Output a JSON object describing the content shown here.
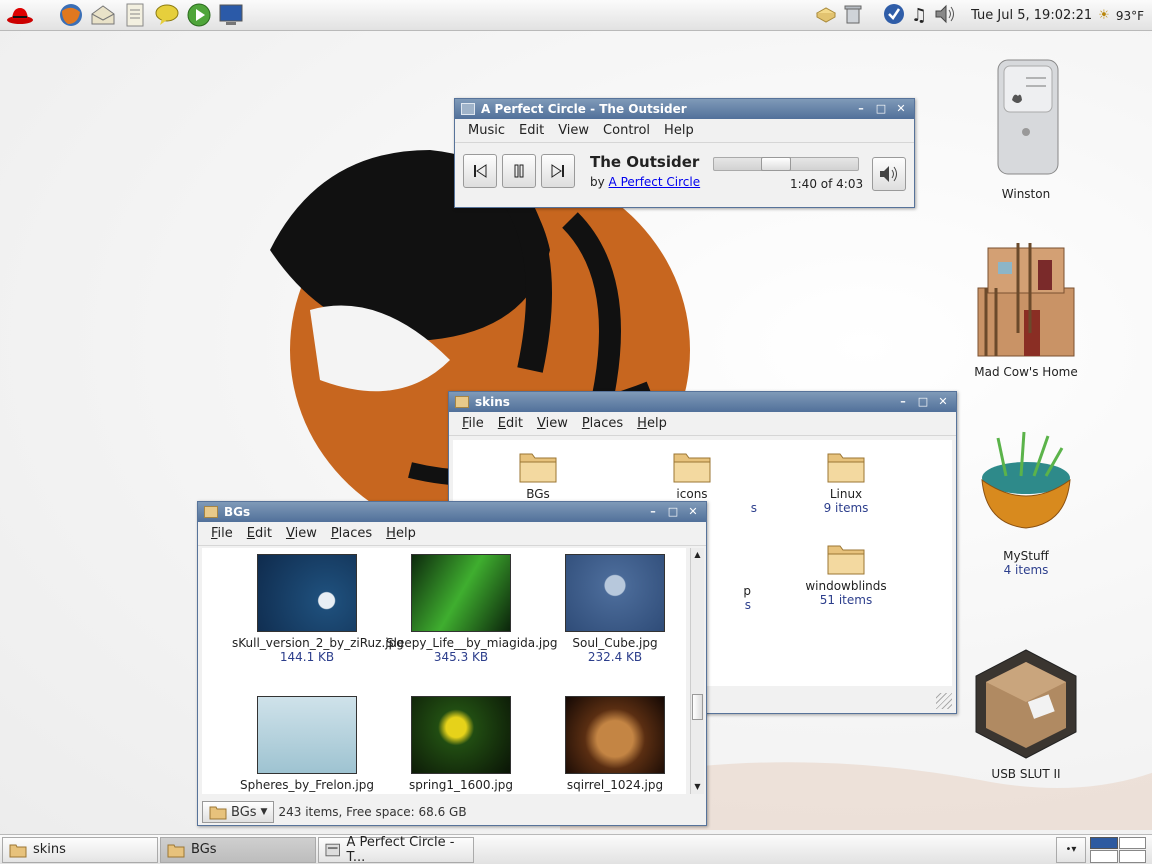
{
  "top_panel": {
    "clock": "Tue Jul  5, 19:02:21",
    "weather": "93°F",
    "launchers": [
      "redhat-menu-icon",
      "firefox-icon",
      "mail-icon",
      "notes-icon",
      "chat-icon",
      "media-player-icon",
      "monitor-icon"
    ]
  },
  "desktop": {
    "icons": [
      {
        "label": "Winston",
        "sub": ""
      },
      {
        "label": "Mad Cow's Home",
        "sub": ""
      },
      {
        "label": "MyStuff",
        "sub": "4 items"
      },
      {
        "label": "USB SLUT II",
        "sub": ""
      }
    ]
  },
  "player": {
    "title": "A Perfect Circle - The Outsider",
    "menu": [
      "Music",
      "Edit",
      "View",
      "Control",
      "Help"
    ],
    "song": "The Outsider",
    "by_prefix": "by",
    "artist": "A Perfect Circle",
    "time": "1:40 of 4:03",
    "progress": 0.41
  },
  "skins": {
    "title": "skins",
    "menu": [
      "File",
      "Edit",
      "View",
      "Places",
      "Help"
    ],
    "items": [
      {
        "name": "BGs",
        "size": ""
      },
      {
        "name": "icons",
        "size": "s"
      },
      {
        "name": "Linux",
        "size": "9 items"
      },
      {
        "name": "p",
        "size": "s"
      },
      {
        "name": "windowblinds",
        "size": "51 items"
      }
    ]
  },
  "bgs": {
    "title": "BGs",
    "menu": [
      "File",
      "Edit",
      "View",
      "Places",
      "Help"
    ],
    "items": [
      {
        "name": "sKull_version_2_by_ziRuz.jpg",
        "size": "144.1 KB"
      },
      {
        "name": "Sleepy_Life__by_miagida.jpg",
        "size": "345.3 KB"
      },
      {
        "name": "Soul_Cube.jpg",
        "size": "232.4 KB"
      },
      {
        "name": "Spheres_by_Frelon.jpg",
        "size": ""
      },
      {
        "name": "spring1_1600.jpg",
        "size": ""
      },
      {
        "name": "sqirrel_1024.jpg",
        "size": ""
      }
    ],
    "location": "BGs",
    "status": "243 items, Free space: 68.6 GB"
  },
  "taskbar": {
    "tasks": [
      {
        "label": "skins"
      },
      {
        "label": "BGs"
      },
      {
        "label": "A Perfect Circle - T..."
      }
    ]
  }
}
